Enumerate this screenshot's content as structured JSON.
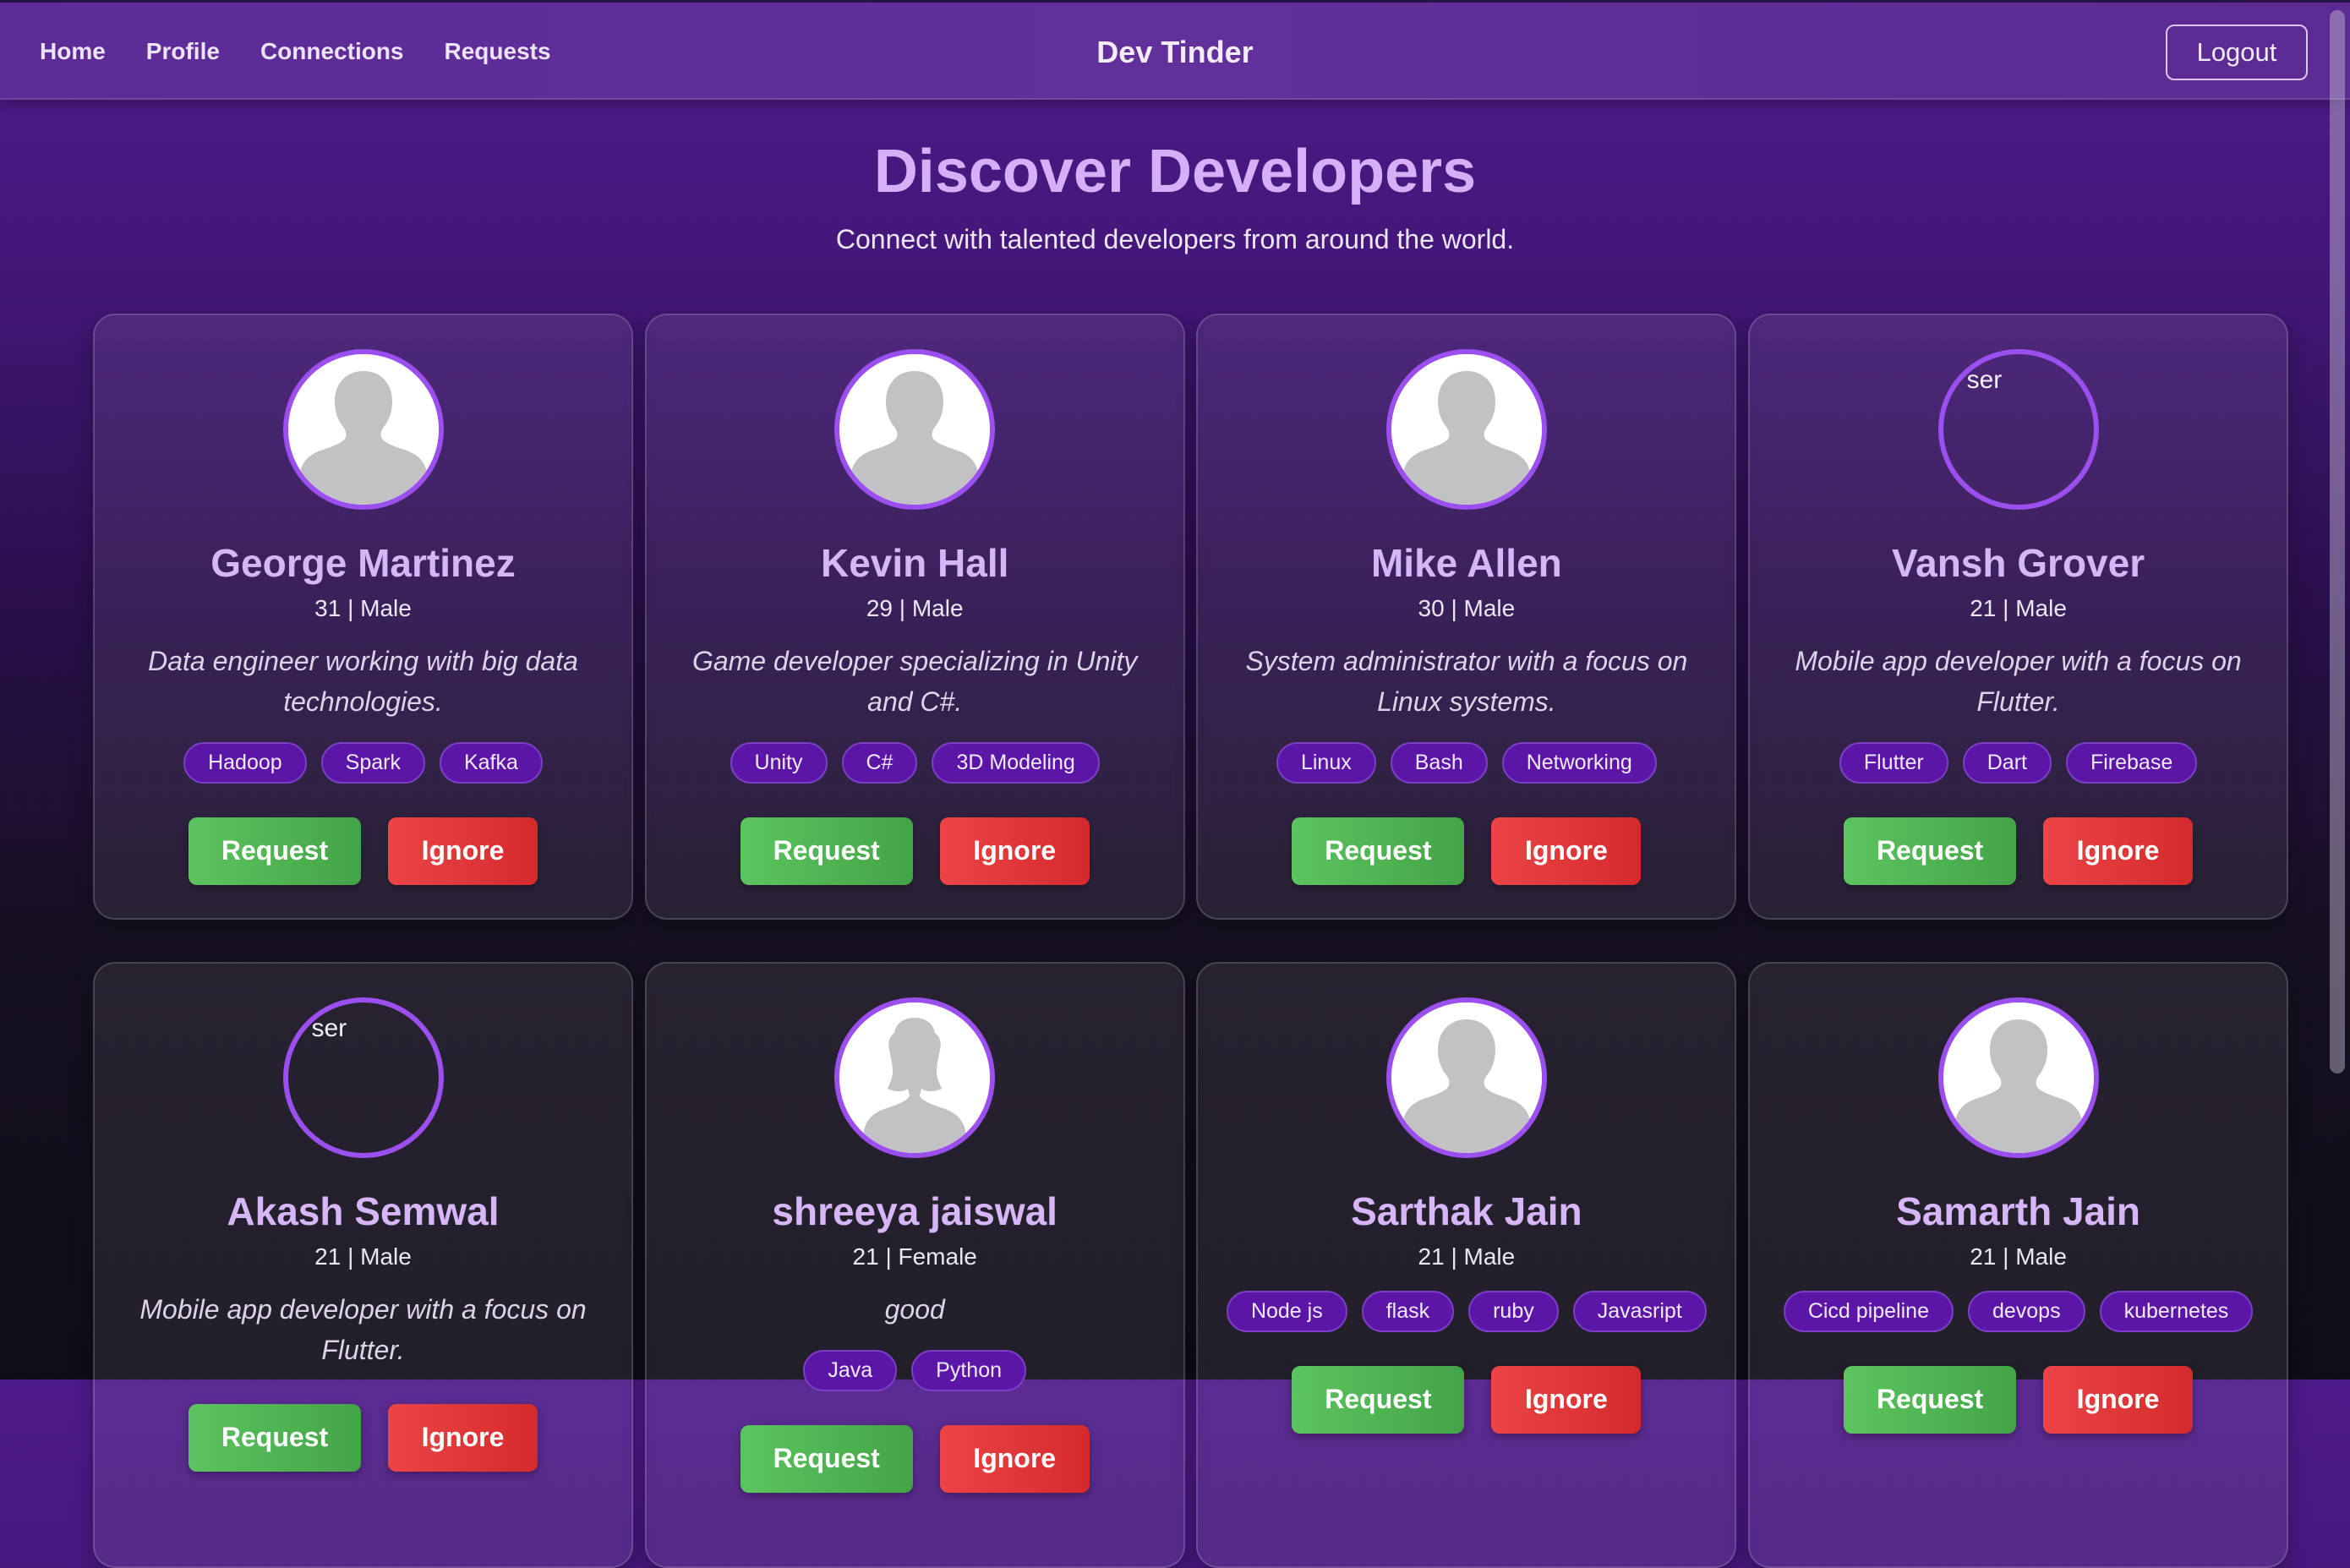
{
  "nav": {
    "links": [
      "Home",
      "Profile",
      "Connections",
      "Requests"
    ],
    "brand": "Dev Tinder",
    "logout_label": "Logout"
  },
  "page": {
    "heading": "Discover Developers",
    "subheading": "Connect with talented developers from around the world."
  },
  "cards": [
    {
      "name": "George Martinez",
      "meta": "31 | Male",
      "bio": "Data engineer working with big data technologies.",
      "skills": [
        "Hadoop",
        "Spark",
        "Kafka"
      ],
      "avatar": "male-silhouette",
      "request_label": "Request",
      "ignore_label": "Ignore"
    },
    {
      "name": "Kevin Hall",
      "meta": "29 | Male",
      "bio": "Game developer specializing in Unity and C#.",
      "skills": [
        "Unity",
        "C#",
        "3D Modeling"
      ],
      "avatar": "male-silhouette",
      "request_label": "Request",
      "ignore_label": "Ignore"
    },
    {
      "name": "Mike Allen",
      "meta": "30 | Male",
      "bio": "System administrator with a focus on Linux systems.",
      "skills": [
        "Linux",
        "Bash",
        "Networking"
      ],
      "avatar": "male-silhouette",
      "request_label": "Request",
      "ignore_label": "Ignore"
    },
    {
      "name": "Vansh Grover",
      "meta": "21 | Male",
      "bio": "Mobile app developer with a focus on Flutter.",
      "skills": [
        "Flutter",
        "Dart",
        "Firebase"
      ],
      "avatar": "broken",
      "avatar_alt": "ser",
      "request_label": "Request",
      "ignore_label": "Ignore"
    },
    {
      "name": "Akash Semwal",
      "meta": "21 | Male",
      "bio": "Mobile app developer with a focus on Flutter.",
      "skills": [],
      "avatar": "broken",
      "avatar_alt": "ser",
      "request_label": "Request",
      "ignore_label": "Ignore"
    },
    {
      "name": "shreeya jaiswal",
      "meta": "21 | Female",
      "bio": "good",
      "skills": [
        "Java",
        "Python"
      ],
      "avatar": "female-silhouette",
      "request_label": "Request",
      "ignore_label": "Ignore"
    },
    {
      "name": "Sarthak Jain",
      "meta": "21 | Male",
      "bio": "",
      "skills": [
        "Node js",
        "flask",
        "ruby",
        "Javasript"
      ],
      "avatar": "male-silhouette",
      "request_label": "Request",
      "ignore_label": "Ignore"
    },
    {
      "name": "Samarth Jain",
      "meta": "21 | Male",
      "bio": "",
      "skills": [
        "Cicd pipeline",
        "devops",
        "kubernetes"
      ],
      "avatar": "male-silhouette",
      "request_label": "Request",
      "ignore_label": "Ignore"
    }
  ]
}
